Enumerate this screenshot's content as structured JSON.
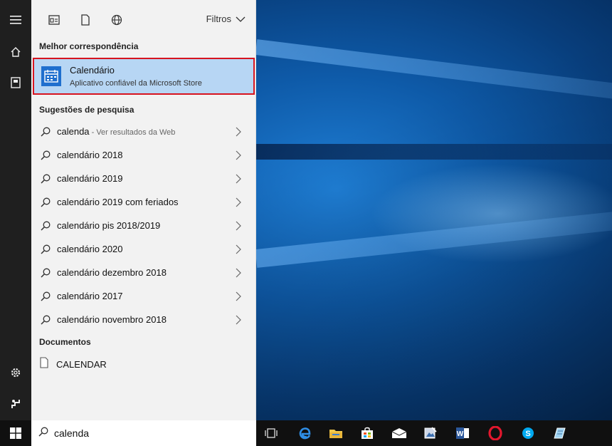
{
  "filters": {
    "label": "Filtros"
  },
  "best_match": {
    "section_title": "Melhor correspondência",
    "title": "Calendário",
    "subtitle": "Aplicativo confiável da Microsoft Store"
  },
  "suggestions": {
    "section_title": "Sugestões de pesquisa",
    "first": {
      "query": "calenda",
      "hint": " - Ver resultados da Web"
    },
    "items": [
      "calendário 2018",
      "calendário 2019",
      "calendário 2019 com feriados",
      "calendário pis 2018/2019",
      "calendário 2020",
      "calendário dezembro 2018",
      "calendário 2017",
      "calendário novembro 2018"
    ]
  },
  "documents": {
    "section_title": "Documentos",
    "items": [
      "CALENDAR"
    ]
  },
  "search": {
    "value": "calenda"
  },
  "colors": {
    "accent": "#1f6fce",
    "highlight": "#b7d6f4",
    "selection_border": "#d7141f"
  }
}
